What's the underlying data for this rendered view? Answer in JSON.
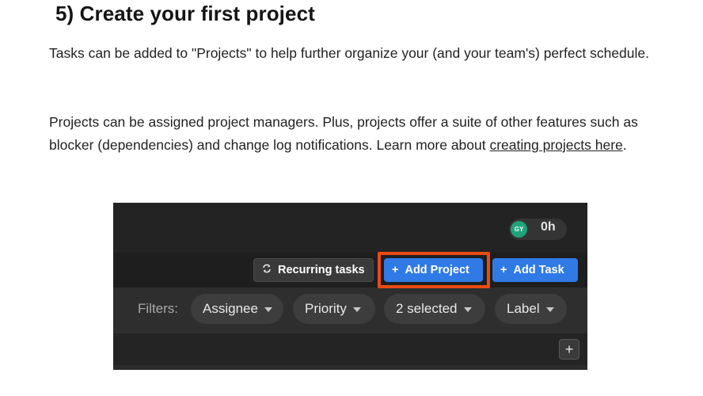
{
  "article": {
    "heading": "5) Create your first project",
    "paragraph1": "Tasks can be added to \"Projects\" to help further organize your (and your team's) perfect schedule.",
    "paragraph2_text": "Projects can be assigned project managers. Plus, projects offer a suite of other features such as blocker (dependencies) and change log notifications. Learn more about ",
    "paragraph2_link": "creating projects here",
    "paragraph2_end": "."
  },
  "screenshot": {
    "avatar_initials": "GY",
    "time_total": "0h",
    "toolbar": {
      "recurring_label": "Recurring tasks",
      "recurring_icon": "repeat-icon",
      "add_project_label": "Add Project",
      "add_task_label": "Add Task",
      "plus_glyph": "+"
    },
    "filters": {
      "label": "Filters:",
      "chips": [
        "Assignee",
        "Priority",
        "2 selected",
        "Label"
      ]
    },
    "add_glyph": "+",
    "colors": {
      "primary_button": "#2f7ae5",
      "highlight_outline": "#ea4b13",
      "avatar": "#1fa37a"
    }
  }
}
